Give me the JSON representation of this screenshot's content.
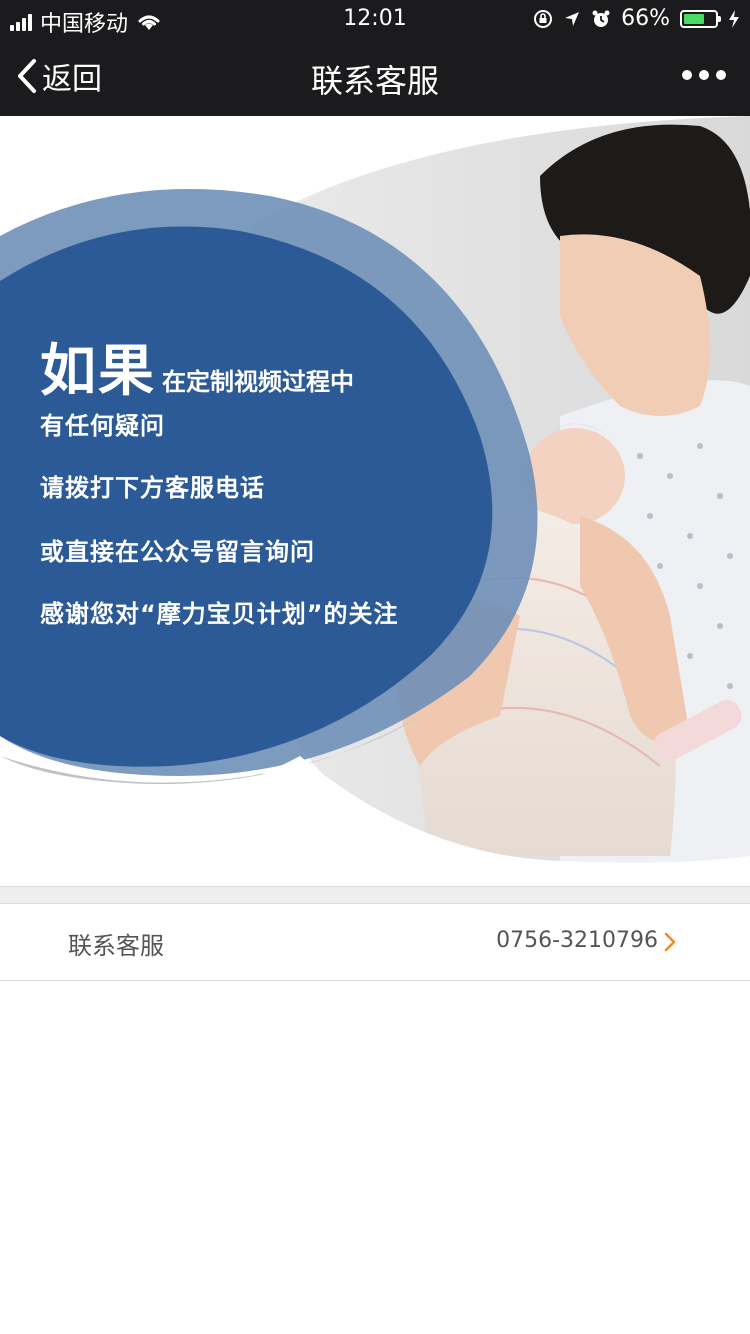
{
  "status_bar": {
    "carrier": "中国移动",
    "time": "12:01",
    "battery_percent": "66%",
    "battery_level": 0.66,
    "icons": [
      "signal-icon",
      "wifi-icon",
      "orientation-lock-icon",
      "location-icon",
      "alarm-icon",
      "battery-icon",
      "charging-icon"
    ]
  },
  "nav": {
    "back_label": "返回",
    "title": "联系客服",
    "more_icon": "more-dots-icon"
  },
  "banner": {
    "hero_big": "如果",
    "hero_small": "在定制视频过程中",
    "lines": [
      "有任何疑问",
      "请拨打下方客服电话",
      "或直接在公众号留言询问",
      "感谢您对“摩力宝贝计划”的关注"
    ]
  },
  "contact": {
    "label": "联系客服",
    "phone": "0756-3210796",
    "arrow_icon": "chevron-right-icon"
  },
  "colors": {
    "nav_bg": "#1b1b1d",
    "banner_blue": "#2b5a96",
    "accent_orange": "#f08a24",
    "battery_green": "#4cd964"
  }
}
